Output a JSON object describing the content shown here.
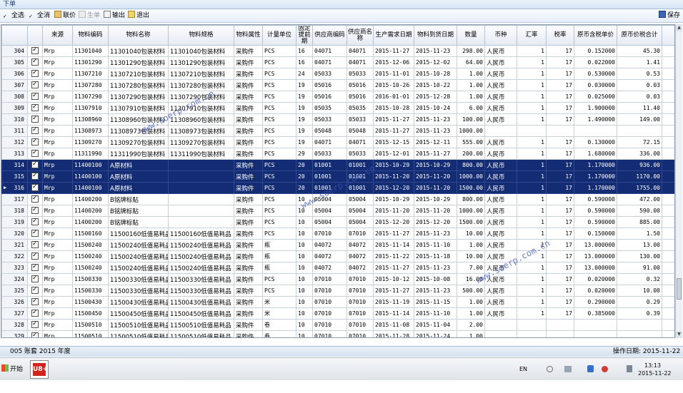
{
  "window": {
    "title": "下单"
  },
  "toolbar": {
    "select_all": "全选",
    "deselect_all": "全消",
    "link_price": "联价",
    "generate": "生单",
    "export": "输出",
    "exit": "退出",
    "save": "保存"
  },
  "grid": {
    "headers": [
      "",
      "",
      "来源",
      "物料编码",
      "物料名称",
      "物料规格",
      "物料属性",
      "计量单位",
      "固定提前期",
      "供应商编码",
      "供应商名称",
      "生产需求日期",
      "物料到货日期",
      "数量",
      "币种",
      "汇率",
      "税率",
      "原币含税单价",
      "原币价税合计",
      "原"
    ],
    "rows": [
      {
        "no": "304",
        "src": "Mrp",
        "code": "11301040",
        "name": "11301040包装材料",
        "spec": "11301040包装材料",
        "attr": "采购件",
        "unit": "PCS",
        "lead": "16",
        "vcode": "04071",
        "vname": "04071",
        "need": "2015-11-27",
        "arrive": "2015-11-23",
        "qty": "298.00",
        "cur": "人民币",
        "rate": "1",
        "tax": "17",
        "price": "0.152000",
        "total": "45.30"
      },
      {
        "no": "305",
        "src": "Mrp",
        "code": "11301290",
        "name": "11301290包装材料",
        "spec": "11301290包装材料",
        "attr": "采购件",
        "unit": "PCS",
        "lead": "16",
        "vcode": "04071",
        "vname": "04071",
        "need": "2015-12-06",
        "arrive": "2015-12-02",
        "qty": "64.00",
        "cur": "人民币",
        "rate": "1",
        "tax": "17",
        "price": "0.022000",
        "total": "1.41"
      },
      {
        "no": "306",
        "src": "Mrp",
        "code": "11307210",
        "name": "11307210包装材料",
        "spec": "11307210包装材料",
        "attr": "采购件",
        "unit": "PCS",
        "lead": "24",
        "vcode": "05033",
        "vname": "05033",
        "need": "2015-11-01",
        "arrive": "2015-10-28",
        "qty": "1.00",
        "cur": "人民币",
        "rate": "1",
        "tax": "17",
        "price": "0.530000",
        "total": "0.53"
      },
      {
        "no": "307",
        "src": "Mrp",
        "code": "11307280",
        "name": "11307280包装材料",
        "spec": "11307280包装材料",
        "attr": "采购件",
        "unit": "PCS",
        "lead": "19",
        "vcode": "05016",
        "vname": "05016",
        "need": "2015-10-26",
        "arrive": "2015-10-22",
        "qty": "1.00",
        "cur": "人民币",
        "rate": "1",
        "tax": "17",
        "price": "0.030000",
        "total": "0.03"
      },
      {
        "no": "308",
        "src": "Mrp",
        "code": "11307290",
        "name": "11307290包装材料",
        "spec": "11307290包装材料",
        "attr": "采购件",
        "unit": "PCS",
        "lead": "19",
        "vcode": "05016",
        "vname": "05016",
        "need": "2016-01-01",
        "arrive": "2015-12-28",
        "qty": "1.00",
        "cur": "人民币",
        "rate": "1",
        "tax": "17",
        "price": "0.025000",
        "total": "0.03"
      },
      {
        "no": "309",
        "src": "Mrp",
        "code": "11307910",
        "name": "11307910包装材料",
        "spec": "11307910包装材料",
        "attr": "采购件",
        "unit": "PCS",
        "lead": "19",
        "vcode": "05035",
        "vname": "05035",
        "need": "2015-10-28",
        "arrive": "2015-10-24",
        "qty": "6.00",
        "cur": "人民币",
        "rate": "1",
        "tax": "17",
        "price": "1.900000",
        "total": "11.40"
      },
      {
        "no": "310",
        "src": "Mrp",
        "code": "11308960",
        "name": "11308960包装材料",
        "spec": "11308960包装材料",
        "attr": "采购件",
        "unit": "PCS",
        "lead": "19",
        "vcode": "05033",
        "vname": "05033",
        "need": "2015-11-27",
        "arrive": "2015-11-23",
        "qty": "100.00",
        "cur": "人民币",
        "rate": "1",
        "tax": "17",
        "price": "1.490000",
        "total": "149.00"
      },
      {
        "no": "311",
        "src": "Mrp",
        "code": "11308973",
        "name": "11308973包装材料",
        "spec": "11308973包装材料",
        "attr": "采购件",
        "unit": "PCS",
        "lead": "19",
        "vcode": "05048",
        "vname": "05048",
        "need": "2015-11-27",
        "arrive": "2015-11-23",
        "qty": "1000.00",
        "cur": "",
        "rate": "",
        "tax": "",
        "price": "",
        "total": ""
      },
      {
        "no": "312",
        "src": "Mrp",
        "code": "11309270",
        "name": "11309270包装材料",
        "spec": "11309270包装材料",
        "attr": "采购件",
        "unit": "PCS",
        "lead": "19",
        "vcode": "04071",
        "vname": "04071",
        "need": "2015-12-15",
        "arrive": "2015-12-11",
        "qty": "555.00",
        "cur": "人民币",
        "rate": "1",
        "tax": "17",
        "price": "0.130000",
        "total": "72.15"
      },
      {
        "no": "313",
        "src": "Mrp",
        "code": "11311990",
        "name": "11311990包装材料",
        "spec": "11311990包装材料",
        "attr": "采购件",
        "unit": "PCS",
        "lead": "29",
        "vcode": "05033",
        "vname": "05033",
        "need": "2015-12-01",
        "arrive": "2015-11-27",
        "qty": "200.00",
        "cur": "人民币",
        "rate": "1",
        "tax": "17",
        "price": "1.680000",
        "total": "336.00"
      },
      {
        "no": "314",
        "src": "Mrp",
        "code": "11400100",
        "name": "A原材料",
        "spec": "",
        "attr": "采购件",
        "unit": "PCS",
        "lead": "20",
        "vcode": "01001",
        "vname": "01001",
        "need": "2015-10-29",
        "arrive": "2015-10-29",
        "qty": "800.00",
        "cur": "人民币",
        "rate": "1",
        "tax": "17",
        "price": "1.170000",
        "total": "936.00",
        "sel": true
      },
      {
        "no": "315",
        "src": "Mrp",
        "code": "11400100",
        "name": "A原材料",
        "spec": "",
        "attr": "采购件",
        "unit": "PCS",
        "lead": "20",
        "vcode": "01001",
        "vname": "01001",
        "need": "2015-11-20",
        "arrive": "2015-11-20",
        "qty": "1000.00",
        "cur": "人民币",
        "rate": "1",
        "tax": "17",
        "price": "1.170000",
        "total": "1170.00",
        "sel": true
      },
      {
        "no": "316",
        "src": "Mrp",
        "code": "11400100",
        "name": "A原材料",
        "spec": "",
        "attr": "采购件",
        "unit": "PCS",
        "lead": "20",
        "vcode": "01001",
        "vname": "01001",
        "need": "2015-12-20",
        "arrive": "2015-11-20",
        "qty": "1500.00",
        "cur": "人民币",
        "rate": "1",
        "tax": "17",
        "price": "1.170000",
        "total": "1755.00",
        "sel": true,
        "current": true
      },
      {
        "no": "317",
        "src": "Mrp",
        "code": "11400200",
        "name": "B铭牌标贴",
        "spec": "",
        "attr": "采购件",
        "unit": "PCS",
        "lead": "10",
        "vcode": "05004",
        "vname": "05004",
        "need": "2015-10-29",
        "arrive": "2015-10-29",
        "qty": "800.00",
        "cur": "人民币",
        "rate": "1",
        "tax": "17",
        "price": "0.590000",
        "total": "472.00"
      },
      {
        "no": "318",
        "src": "Mrp",
        "code": "11400200",
        "name": "B铭牌标贴",
        "spec": "",
        "attr": "采购件",
        "unit": "PCS",
        "lead": "10",
        "vcode": "05004",
        "vname": "05004",
        "need": "2015-11-20",
        "arrive": "2015-11-20",
        "qty": "1000.00",
        "cur": "人民币",
        "rate": "1",
        "tax": "17",
        "price": "0.590000",
        "total": "590.00"
      },
      {
        "no": "319",
        "src": "Mrp",
        "code": "11400200",
        "name": "B铭牌标贴",
        "spec": "",
        "attr": "采购件",
        "unit": "PCS",
        "lead": "10",
        "vcode": "05004",
        "vname": "05004",
        "need": "2015-12-20",
        "arrive": "2015-12-20",
        "qty": "1500.00",
        "cur": "人民币",
        "rate": "1",
        "tax": "17",
        "price": "0.590000",
        "total": "885.00"
      },
      {
        "no": "320",
        "src": "Mrp",
        "code": "11500160",
        "name": "11500160低值易耗品",
        "spec": "11500160低值易耗品",
        "attr": "采购件",
        "unit": "PCS",
        "lead": "10",
        "vcode": "07010",
        "vname": "07010",
        "need": "2015-11-27",
        "arrive": "2015-11-23",
        "qty": "10.00",
        "cur": "人民币",
        "rate": "1",
        "tax": "17",
        "price": "0.150000",
        "total": "1.50"
      },
      {
        "no": "321",
        "src": "Mrp",
        "code": "11500240",
        "name": "11500240低值易耗品",
        "spec": "11500240低值易耗品",
        "attr": "采购件",
        "unit": "瓶",
        "lead": "10",
        "vcode": "04072",
        "vname": "04072",
        "need": "2015-11-14",
        "arrive": "2015-11-10",
        "qty": "1.00",
        "cur": "人民币",
        "rate": "1",
        "tax": "17",
        "price": "13.000000",
        "total": "13.00"
      },
      {
        "no": "322",
        "src": "Mrp",
        "code": "11500240",
        "name": "11500240低值易耗品",
        "spec": "11500240低值易耗品",
        "attr": "采购件",
        "unit": "瓶",
        "lead": "10",
        "vcode": "04072",
        "vname": "04072",
        "need": "2015-11-22",
        "arrive": "2015-11-18",
        "qty": "10.00",
        "cur": "人民币",
        "rate": "1",
        "tax": "17",
        "price": "13.000000",
        "total": "130.00"
      },
      {
        "no": "323",
        "src": "Mrp",
        "code": "11500240",
        "name": "11500240低值易耗品",
        "spec": "11500240低值易耗品",
        "attr": "采购件",
        "unit": "瓶",
        "lead": "10",
        "vcode": "04072",
        "vname": "04072",
        "need": "2015-11-27",
        "arrive": "2015-11-23",
        "qty": "7.00",
        "cur": "人民币",
        "rate": "1",
        "tax": "17",
        "price": "13.000000",
        "total": "91.00"
      },
      {
        "no": "324",
        "src": "Mrp",
        "code": "11500330",
        "name": "11500330低值易耗品",
        "spec": "11500330低值易耗品",
        "attr": "采购件",
        "unit": "PCS",
        "lead": "10",
        "vcode": "07010",
        "vname": "07010",
        "need": "2015-10-12",
        "arrive": "2015-10-08",
        "qty": "16.00",
        "cur": "人民币",
        "rate": "1",
        "tax": "17",
        "price": "0.020000",
        "total": "0.32"
      },
      {
        "no": "325",
        "src": "Mrp",
        "code": "11500330",
        "name": "11500330低值易耗品",
        "spec": "11500330低值易耗品",
        "attr": "采购件",
        "unit": "PCS",
        "lead": "10",
        "vcode": "07010",
        "vname": "07010",
        "need": "2015-11-27",
        "arrive": "2015-11-23",
        "qty": "500.00",
        "cur": "人民币",
        "rate": "1",
        "tax": "17",
        "price": "0.020000",
        "total": "10.00"
      },
      {
        "no": "326",
        "src": "Mrp",
        "code": "11500430",
        "name": "11500430低值易耗品",
        "spec": "11500430低值易耗品",
        "attr": "采购件",
        "unit": "米",
        "lead": "10",
        "vcode": "07010",
        "vname": "07010",
        "need": "2015-11-19",
        "arrive": "2015-11-15",
        "qty": "1.00",
        "cur": "人民币",
        "rate": "1",
        "tax": "17",
        "price": "0.290000",
        "total": "0.29"
      },
      {
        "no": "327",
        "src": "Mrp",
        "code": "11500450",
        "name": "11500450低值易耗品",
        "spec": "11500450低值易耗品",
        "attr": "采购件",
        "unit": "米",
        "lead": "10",
        "vcode": "07010",
        "vname": "07010",
        "need": "2015-11-14",
        "arrive": "2015-11-10",
        "qty": "1.00",
        "cur": "人民币",
        "rate": "1",
        "tax": "17",
        "price": "0.385000",
        "total": "0.39"
      },
      {
        "no": "328",
        "src": "Mrp",
        "code": "11500510",
        "name": "11500510低值易耗品",
        "spec": "11500510低值易耗品",
        "attr": "采购件",
        "unit": "卷",
        "lead": "10",
        "vcode": "07010",
        "vname": "07010",
        "need": "2015-11-08",
        "arrive": "2015-11-04",
        "qty": "2.00",
        "cur": "",
        "rate": "",
        "tax": "",
        "price": "",
        "total": ""
      },
      {
        "no": "329",
        "src": "Mrp",
        "code": "11500510",
        "name": "11500510低值易耗品",
        "spec": "11500510低值易耗品",
        "attr": "采购件",
        "unit": "卷",
        "lead": "10",
        "vcode": "07010",
        "vname": "07010",
        "need": "2015-11-28",
        "arrive": "2015-11-24",
        "qty": "1.00",
        "cur": "",
        "rate": "",
        "tax": "",
        "price": "",
        "total": ""
      }
    ]
  },
  "statusbar": {
    "account": "005 账套 2015 年度",
    "op_date": "操作日期: 2015-11-22"
  },
  "taskbar": {
    "start": "开始",
    "app": "U8+",
    "lang": "EN",
    "time": "13:13",
    "date": "2015-11-22"
  },
  "watermark": "www.soerp.com.cn",
  "colors": {
    "selected_row": "#132c74",
    "header_bg": "#e5ebf3"
  }
}
